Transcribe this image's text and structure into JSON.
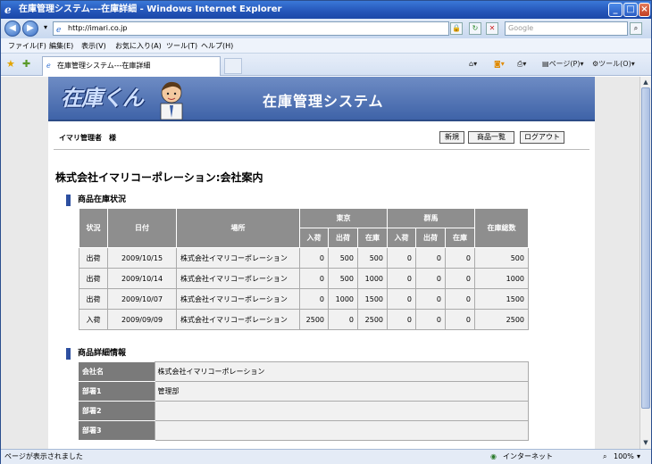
{
  "window": {
    "title": "在庫管理システム---在庫詳細 - Windows Internet Explorer",
    "url": "http://imari.co.jp",
    "search_placeholder": "Google"
  },
  "menu": [
    "ファイル(F)",
    "編集(E)",
    "表示(V)",
    "お気に入り(A)",
    "ツール(T)",
    "ヘルプ(H)"
  ],
  "tab": {
    "label": "在庫管理システム---在庫詳細"
  },
  "commands": {
    "page": "ページ(P)",
    "tools": "ツール(O)"
  },
  "banner": {
    "logo": "在庫くん",
    "title": "在庫管理システム"
  },
  "header": {
    "user": "イマリ管理者　様",
    "buttons": {
      "new": "新規",
      "list": "商品一覧",
      "logout": "ログアウト"
    }
  },
  "page_title": "株式会社イマリコーポレーション:会社案内",
  "stock": {
    "section_title": "商品在庫状況",
    "headers": {
      "status": "状況",
      "date": "日付",
      "location": "場所",
      "tokyo": "東京",
      "gunma": "群馬",
      "total": "在庫総数",
      "in": "入荷",
      "out": "出荷",
      "stock": "在庫"
    },
    "rows": [
      {
        "status": "出荷",
        "date": "2009/10/15",
        "location": "株式会社イマリコーポレーション",
        "t_in": "0",
        "t_out": "500",
        "t_stock": "500",
        "g_in": "0",
        "g_out": "0",
        "g_stock": "0",
        "total": "500"
      },
      {
        "status": "出荷",
        "date": "2009/10/14",
        "location": "株式会社イマリコーポレーション",
        "t_in": "0",
        "t_out": "500",
        "t_stock": "1000",
        "g_in": "0",
        "g_out": "0",
        "g_stock": "0",
        "total": "1000"
      },
      {
        "status": "出荷",
        "date": "2009/10/07",
        "location": "株式会社イマリコーポレーション",
        "t_in": "0",
        "t_out": "1000",
        "t_stock": "1500",
        "g_in": "0",
        "g_out": "0",
        "g_stock": "0",
        "total": "1500"
      },
      {
        "status": "入荷",
        "date": "2009/09/09",
        "location": "株式会社イマリコーポレーション",
        "t_in": "2500",
        "t_out": "0",
        "t_stock": "2500",
        "g_in": "0",
        "g_out": "0",
        "g_stock": "0",
        "total": "2500"
      }
    ]
  },
  "detail": {
    "section_title": "商品詳細情報",
    "rows": [
      {
        "label": "会社名",
        "value": "株式会社イマリコーポレーション"
      },
      {
        "label": "部署1",
        "value": "管理部"
      },
      {
        "label": "部署2",
        "value": ""
      },
      {
        "label": "部署3",
        "value": ""
      }
    ]
  },
  "status": {
    "left": "ページが表示されました",
    "zone": "インターネット",
    "zoom": "100%"
  }
}
